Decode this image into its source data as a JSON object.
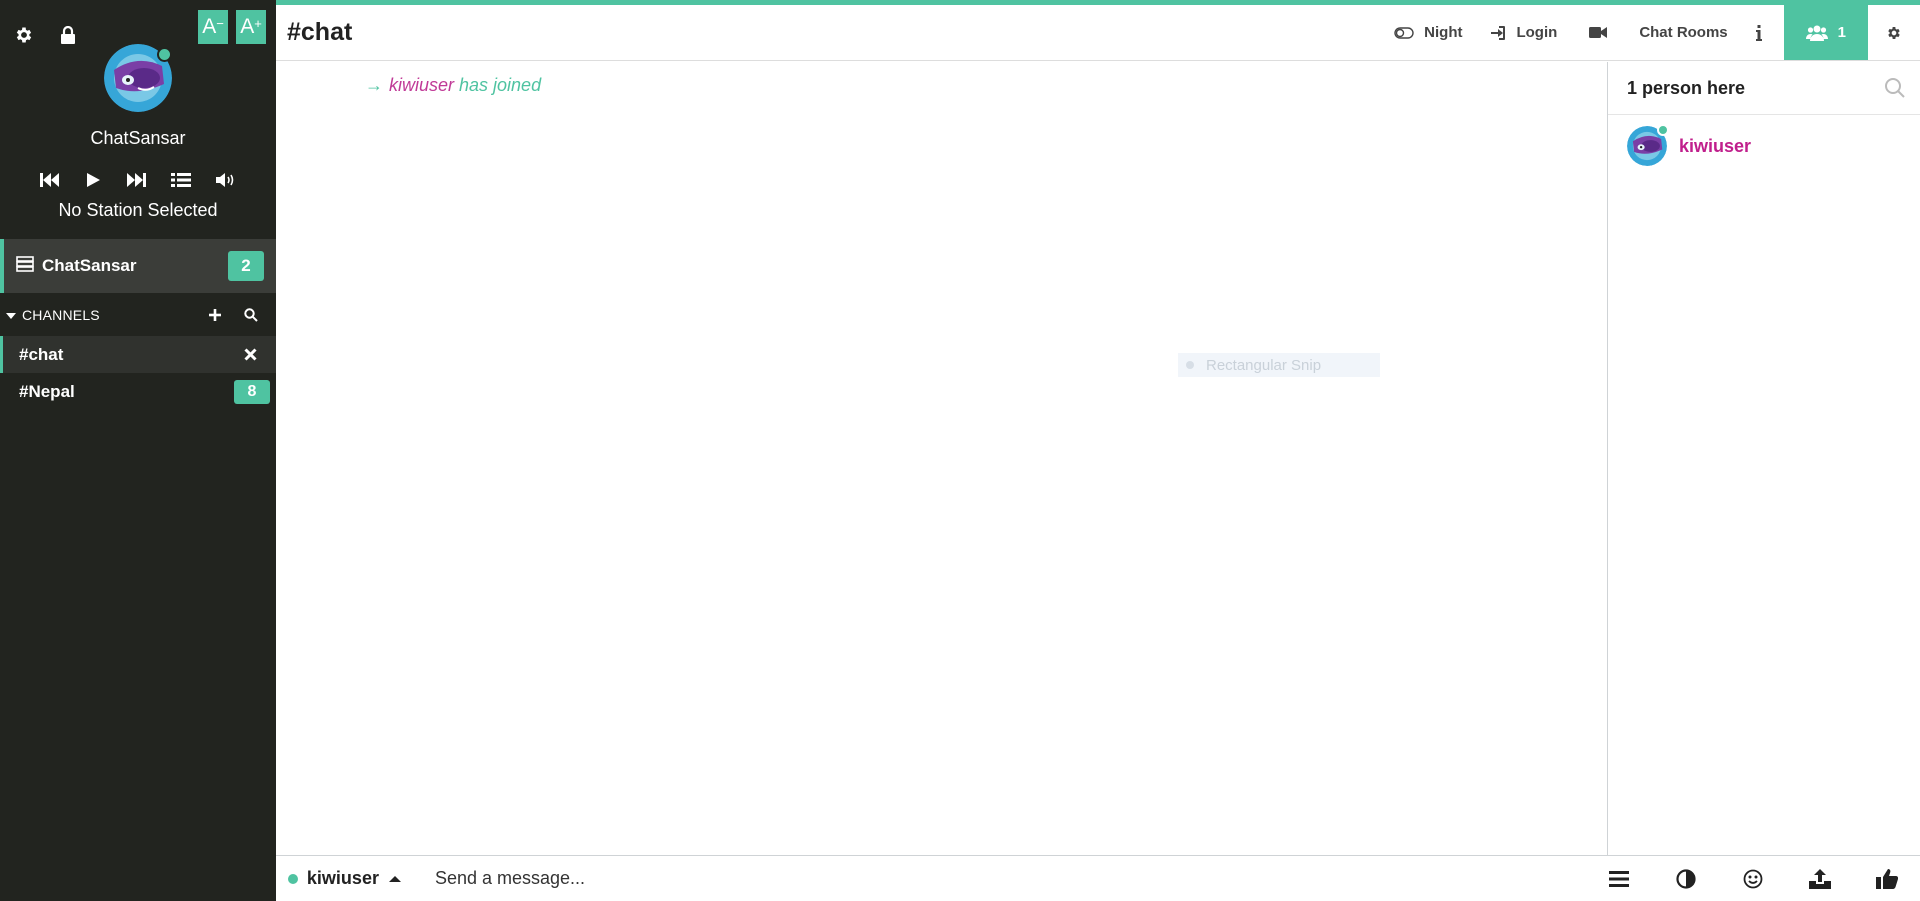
{
  "sidebar": {
    "font_decrease_label": "A",
    "font_increase_label": "A",
    "network_name": "ChatSansar",
    "player": {
      "station": "No Station Selected"
    },
    "network": {
      "label": "ChatSansar",
      "badge": "2"
    },
    "channels_header": "CHANNELS",
    "channels": [
      {
        "label": "#chat",
        "active": true
      },
      {
        "label": "#Nepal",
        "badge": "8"
      }
    ]
  },
  "header": {
    "channel_title": "#chat",
    "night_label": "Night",
    "login_label": "Login",
    "chat_rooms_label": "Chat Rooms",
    "people_count": "1"
  },
  "messages": [
    {
      "arrow": "→",
      "nick": "kiwiuser",
      "text": "has joined"
    }
  ],
  "overlay": {
    "snip_label": "Rectangular Snip"
  },
  "members": {
    "header": "1 person here",
    "list": [
      {
        "nick": "kiwiuser"
      }
    ]
  },
  "input": {
    "nick": "kiwiuser",
    "placeholder": "Send a message..."
  },
  "colors": {
    "accent": "#4fc3a1",
    "sidebar_bg": "#22241f",
    "nick_color": "#c01f8c"
  },
  "icons": [
    "gear-icon",
    "lock-icon",
    "previous-track-icon",
    "play-icon",
    "next-track-icon",
    "playlist-icon",
    "volume-icon",
    "server-icon",
    "caret-down-icon",
    "plus-icon",
    "search-icon",
    "close-icon",
    "toggle-icon",
    "sign-in-icon",
    "video-camera-icon",
    "info-icon",
    "users-icon",
    "caret-up-icon",
    "menu-icon",
    "contrast-icon",
    "emoji-icon",
    "upload-icon",
    "thumbs-up-icon"
  ]
}
